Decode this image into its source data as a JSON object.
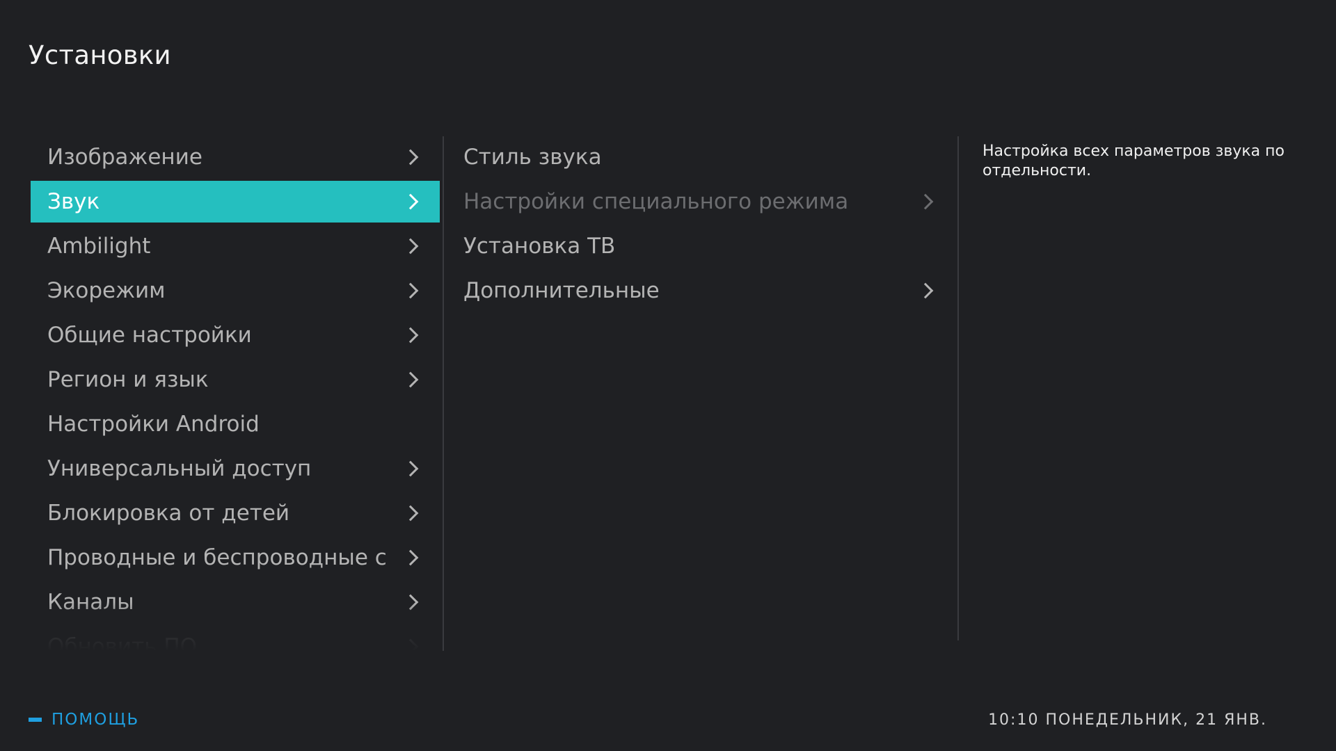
{
  "header": {
    "title": "Установки"
  },
  "left_menu": {
    "items": [
      {
        "label": "Изображение",
        "has_submenu": true,
        "selected": false
      },
      {
        "label": "Звук",
        "has_submenu": true,
        "selected": true
      },
      {
        "label": "Ambilight",
        "has_submenu": true,
        "selected": false
      },
      {
        "label": "Экорежим",
        "has_submenu": true,
        "selected": false
      },
      {
        "label": "Общие настройки",
        "has_submenu": true,
        "selected": false
      },
      {
        "label": "Регион и язык",
        "has_submenu": true,
        "selected": false
      },
      {
        "label": "Настройки Android",
        "has_submenu": false,
        "selected": false
      },
      {
        "label": "Универсальный доступ",
        "has_submenu": true,
        "selected": false
      },
      {
        "label": "Блокировка от детей",
        "has_submenu": true,
        "selected": false
      },
      {
        "label": "Проводные и беспроводные сети",
        "has_submenu": true,
        "selected": false
      },
      {
        "label": "Каналы",
        "has_submenu": true,
        "selected": false
      },
      {
        "label": "Обновить ПО",
        "has_submenu": true,
        "selected": false
      }
    ]
  },
  "sub_menu": {
    "items": [
      {
        "label": "Стиль звука",
        "has_submenu": false,
        "disabled": false
      },
      {
        "label": "Настройки специального режима",
        "has_submenu": true,
        "disabled": true
      },
      {
        "label": "Установка ТВ",
        "has_submenu": false,
        "disabled": false
      },
      {
        "label": "Дополнительные",
        "has_submenu": true,
        "disabled": false
      }
    ]
  },
  "description": {
    "text": "Настройка всех параметров звука по отдельности."
  },
  "footer": {
    "help_label": "ПОМОЩЬ",
    "clock": "10:10 ПОНЕДЕЛЬНИК, 21 ЯНВ."
  },
  "colors": {
    "background": "#1f2023",
    "accent_selected": "#25bfbf",
    "help_blue": "#1f9fe0",
    "text_normal": "#b4b4b4",
    "text_disabled": "#6c6d70"
  }
}
